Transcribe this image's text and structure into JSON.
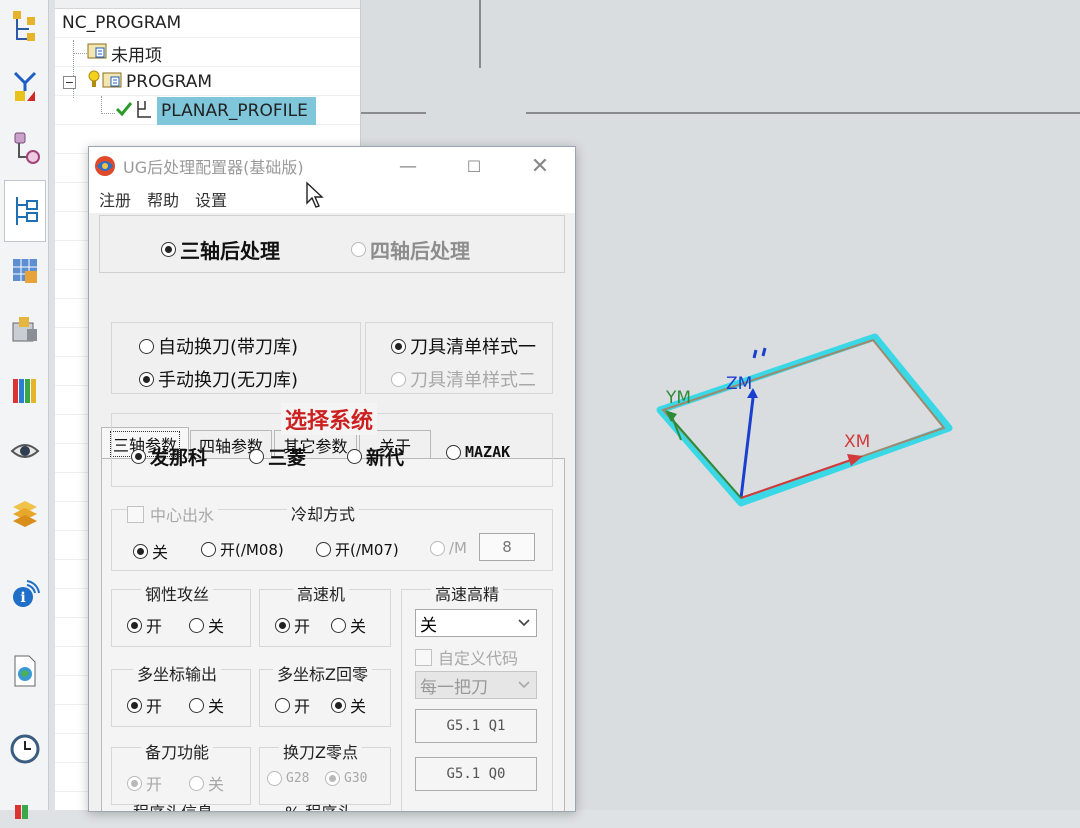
{
  "navigator": {
    "root": "NC_PROGRAM",
    "unused": "未用项",
    "program": "PROGRAM",
    "operation": "PLANAR_PROFILE"
  },
  "viewport": {
    "axis_ym": "YM",
    "axis_zm": "ZM",
    "axis_xm": "XM"
  },
  "dialog": {
    "title": "UG后处理配置器(基础版)",
    "menu": [
      "注册",
      "帮助",
      "设置"
    ],
    "mode": {
      "three_axis": "三轴后处理",
      "four_axis": "四轴后处理",
      "selected": "three_axis"
    },
    "tabs": [
      "三轴参数",
      "四轴参数",
      "其它参数",
      "关于"
    ],
    "toolchange": {
      "auto": "自动换刀(带刀库)",
      "manual": "手动换刀(无刀库)",
      "selected": "manual"
    },
    "toollist": {
      "style1": "刀具清单样式一",
      "style2": "刀具清单样式二",
      "selected": "style1"
    },
    "system": {
      "title": "选择系统",
      "options": [
        "发那科",
        "三菱",
        "新代",
        "MAZAK"
      ],
      "selected": "发那科"
    },
    "coolant": {
      "center_water": "中心出水",
      "title": "冷却方式",
      "off": "关",
      "on_m08": "开(/M08)",
      "on_m07": "开(/M07)",
      "m_custom": "/M",
      "m_value": "8",
      "selected": "off"
    },
    "rigid_tap": {
      "title": "钢性攻丝",
      "on": "开",
      "off": "关",
      "selected": "on"
    },
    "high_speed": {
      "title": "高速机",
      "on": "开",
      "off": "关",
      "selected": "on"
    },
    "hs_precision": {
      "title": "高速高精",
      "value": "关",
      "custom_code": "自定义代码",
      "per_tool": "每一把刀",
      "btn_on": "G5.1 Q1",
      "btn_off": "G5.1 Q0"
    },
    "multi_coord": {
      "title": "多坐标输出",
      "on": "开",
      "off": "关",
      "selected": "on"
    },
    "multi_coord_z": {
      "title": "多坐标Z回零",
      "on": "开",
      "off": "关",
      "selected": "off"
    },
    "spare_tool": {
      "title": "备刀功能",
      "on": "开",
      "off": "关",
      "selected": "on"
    },
    "tool_change_z": {
      "title": "换刀Z零点",
      "g28": "G28",
      "g30": "G30",
      "selected": "g30"
    },
    "bottom_labels": {
      "left": "程序头信息",
      "right": "% 程序头"
    }
  },
  "colors": {
    "selection": "#7fc6da",
    "system_title": "#cc1f1f",
    "part_outline": "#3ad8e6",
    "axis_z": "#1a3fd0",
    "axis_x": "#d23b3b",
    "axis_y": "#2f8a3a"
  }
}
